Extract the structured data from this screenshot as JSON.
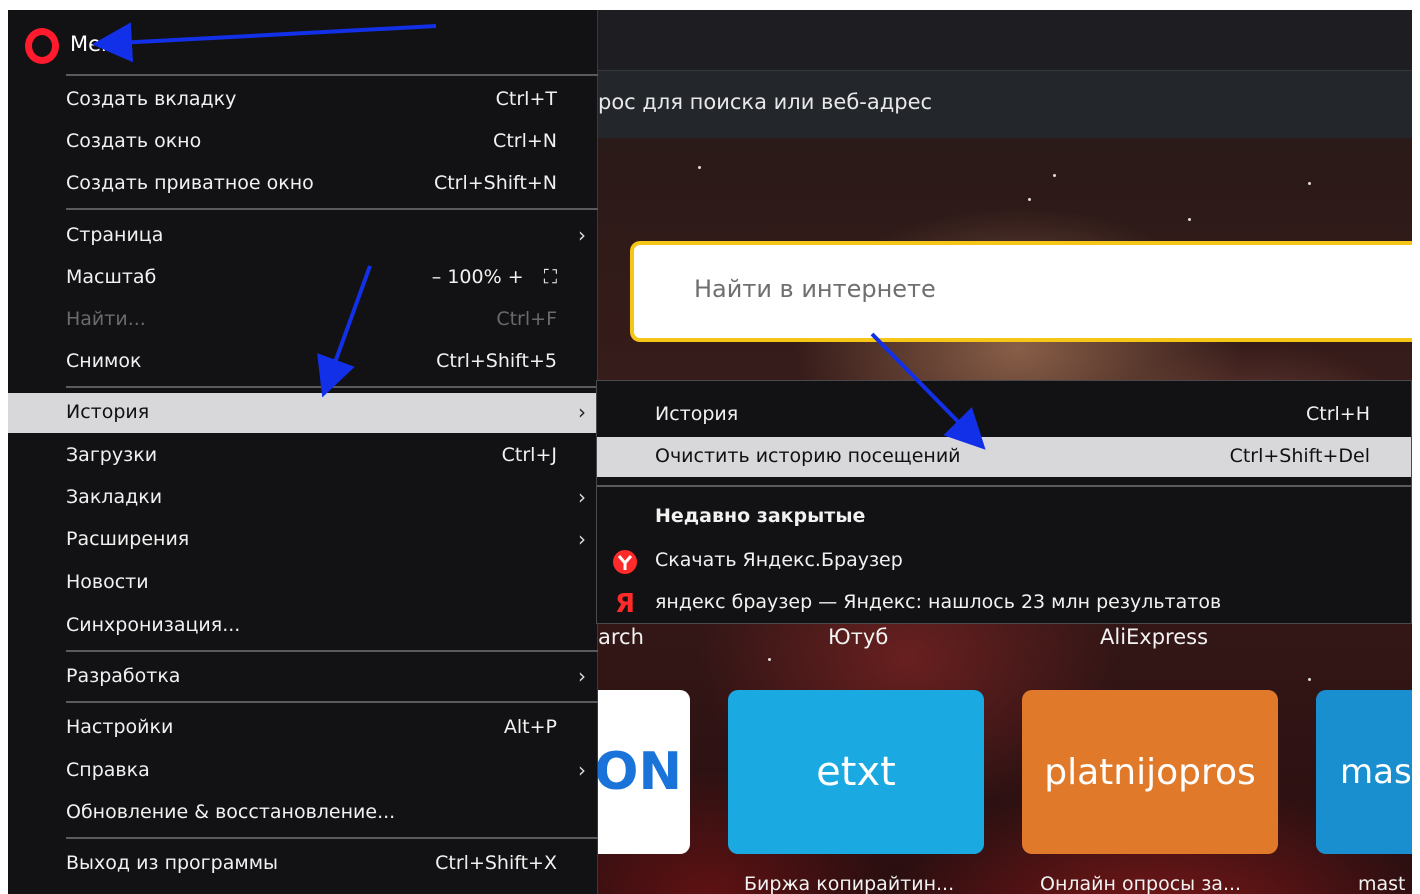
{
  "browser": {
    "address_text": "рос для поиска или веб-адрес",
    "search_placeholder": "Найти в интернете"
  },
  "speed_dial": {
    "labels": [
      "arch",
      "Ютуб",
      "AliExpress"
    ],
    "tiles": [
      {
        "text": "ON",
        "bg": "#ffffff",
        "fg": "#1a73d9",
        "caption": ""
      },
      {
        "text": "etxt",
        "bg": "#1aa9e0",
        "fg": "#ffffff",
        "caption": "Биржа копирайтин..."
      },
      {
        "text": "platnijopros",
        "bg": "#e07a2a",
        "fg": "#ffffff",
        "caption": "Онлайн опросы за..."
      },
      {
        "text": "mast",
        "bg": "#1a8fd0",
        "fg": "#ffffff",
        "caption": "mast"
      }
    ]
  },
  "menu": {
    "title": "Меню",
    "items": [
      {
        "label": "Создать вкладку",
        "shortcut": "Ctrl+T"
      },
      {
        "label": "Создать окно",
        "shortcut": "Ctrl+N"
      },
      {
        "label": "Создать приватное окно",
        "shortcut": "Ctrl+Shift+N"
      },
      {
        "label": "Страница",
        "shortcut": ""
      },
      {
        "label": "Масштаб",
        "shortcut": ""
      },
      {
        "label": "Найти...",
        "shortcut": "Ctrl+F"
      },
      {
        "label": "Снимок",
        "shortcut": "Ctrl+Shift+5"
      },
      {
        "label": "История",
        "shortcut": ""
      },
      {
        "label": "Загрузки",
        "shortcut": "Ctrl+J"
      },
      {
        "label": "Закладки",
        "shortcut": ""
      },
      {
        "label": "Расширения",
        "shortcut": ""
      },
      {
        "label": "Новости",
        "shortcut": ""
      },
      {
        "label": "Синхронизация...",
        "shortcut": ""
      },
      {
        "label": "Разработка",
        "shortcut": ""
      },
      {
        "label": "Настройки",
        "shortcut": "Alt+P"
      },
      {
        "label": "Справка",
        "shortcut": ""
      },
      {
        "label": "Обновление & восстановление...",
        "shortcut": ""
      },
      {
        "label": "Выход из программы",
        "shortcut": "Ctrl+Shift+X"
      }
    ],
    "zoom": {
      "minus": "–",
      "value": "100%",
      "plus": "+",
      "fullscreen": "⛶"
    }
  },
  "history_submenu": {
    "items": [
      {
        "label": "История",
        "shortcut": "Ctrl+H"
      },
      {
        "label": "Очистить историю посещений",
        "shortcut": "Ctrl+Shift+Del"
      }
    ],
    "recent_heading": "Недавно закрытые",
    "recent": [
      {
        "label": "Скачать Яндекс.Браузер",
        "icon": "yandex-browser-icon"
      },
      {
        "label": "яндекс браузер — Яндекс: нашлось 23 млн результатов",
        "icon": "yandex-icon"
      }
    ]
  },
  "colors": {
    "opera_red": "#ff1b2d",
    "search_border": "#f5c518",
    "arrow_blue": "#1230e8",
    "highlight": "#d8d8db"
  }
}
